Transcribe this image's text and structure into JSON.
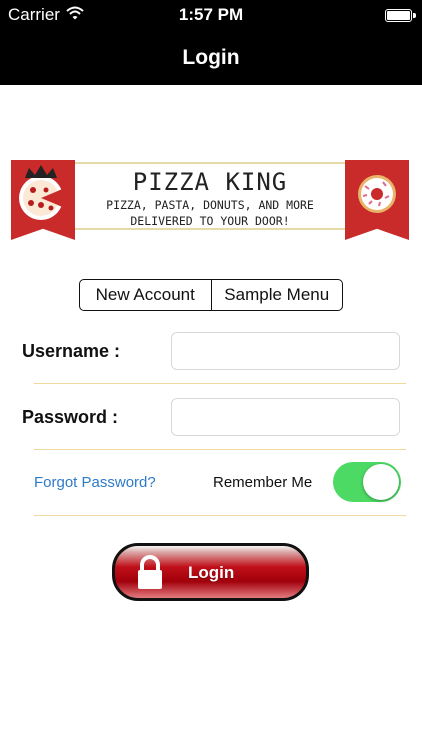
{
  "status_bar": {
    "carrier": "Carrier",
    "time": "1:57 PM"
  },
  "nav": {
    "title": "Login"
  },
  "banner": {
    "brand": "PIZZA KING",
    "tagline_line1": "PIZZA, PASTA, DONUTS, AND MORE",
    "tagline_line2": "DELIVERED TO YOUR DOOR!",
    "left_icon": "pizza-crown-icon",
    "right_icon": "donut-icon",
    "accent_color": "#c92a2a"
  },
  "segments": [
    {
      "label": "New Account"
    },
    {
      "label": "Sample Menu"
    }
  ],
  "form": {
    "username_label": "Username :",
    "username_value": "",
    "password_label": "Password :",
    "password_value": ""
  },
  "options": {
    "forgot_label": "Forgot Password?",
    "remember_label": "Remember Me",
    "remember_on": true,
    "toggle_color": "#4cd964"
  },
  "login_button": {
    "label": "Login",
    "icon": "lock-icon"
  }
}
